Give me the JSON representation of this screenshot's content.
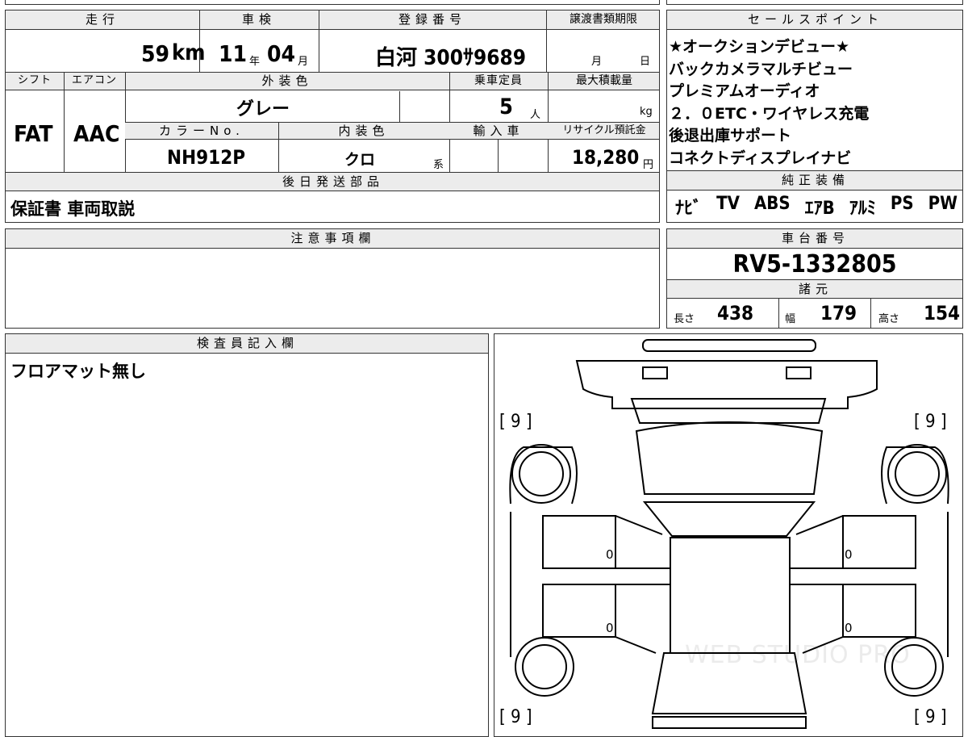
{
  "top_row": {
    "mileage_label": "走行",
    "mileage_value": "59",
    "mileage_unit": "km",
    "inspection_label": "車検",
    "inspection_year": "11",
    "inspection_year_unit": "年",
    "inspection_month": "04",
    "inspection_month_unit": "月",
    "registration_label": "登録番号",
    "registration_value": "白河 300ｻ9689",
    "transfer_label": "譲渡書類期限",
    "transfer_month_unit": "月",
    "transfer_day_unit": "日"
  },
  "mid": {
    "shift_label": "シフト",
    "shift_value": "FAT",
    "ac_label": "エアコン",
    "ac_value": "AAC",
    "exterior_label": "外装色",
    "exterior_value": "グレー",
    "capacity_label": "乗車定員",
    "capacity_value": "5",
    "capacity_unit": "人",
    "load_label": "最大積載量",
    "load_unit": "kg",
    "colorno_label": "カラーNo.",
    "colorno_value": "NH912P",
    "interior_label": "内装色",
    "interior_value": "クロ",
    "interior_suffix": "系",
    "import_label": "輸入車",
    "recycle_label": "リサイクル預託金",
    "recycle_value": "18,280",
    "recycle_unit": "円"
  },
  "later_parts": {
    "label": "後日発送部品",
    "value": "保証書 車両取説"
  },
  "sales_points": {
    "label": "セールスポイント",
    "lines": [
      "★オークションデビュー★",
      "バックカメラマルチビュー",
      "プレミアムオーディオ",
      "２．０ETC・ワイヤレス充電",
      "後退出庫サポート",
      "コネクトディスプレイナビ"
    ]
  },
  "genuine_equipment": {
    "label": "純正装備",
    "items": [
      "ﾅﾋﾞ",
      "TV",
      "ABS",
      "ｴｱB",
      "ｱﾙﾐ",
      "PS",
      "PW"
    ]
  },
  "notes": {
    "label": "注意事項欄",
    "value": ""
  },
  "chassis": {
    "label": "車台番号",
    "value": "RV5-1332805",
    "specs_label": "諸元",
    "length_label": "長さ",
    "length_value": "438",
    "width_label": "幅",
    "width_value": "179",
    "height_label": "高さ",
    "height_value": "154"
  },
  "inspector": {
    "label": "検査員記入欄",
    "value": "フロアマット無し"
  },
  "diagram": {
    "tire_marks": [
      "[ 9 ]",
      "[ 9 ]",
      "[ 9 ]",
      "[ 9 ]"
    ],
    "panel_marks": [
      "0",
      "0",
      "0",
      "0"
    ],
    "watermark": "WEB STUDIO PRO"
  }
}
